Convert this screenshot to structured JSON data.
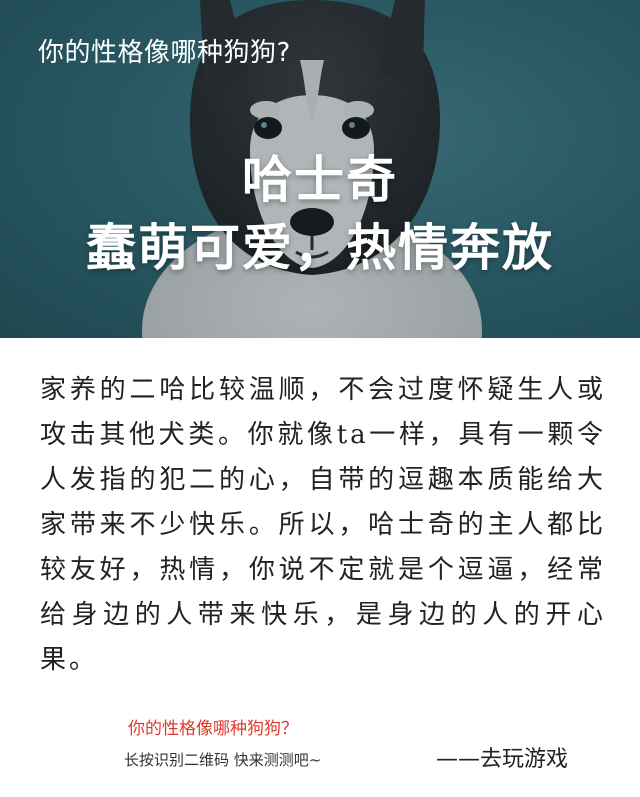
{
  "hero": {
    "question": "你的性格像哪种狗狗?",
    "title_line1": "哈士奇",
    "title_line2": "蠢萌可爱，热情奔放"
  },
  "description": "家养的二哈比较温顺，不会过度怀疑生人或攻击其他犬类。你就像ta一样，具有一颗令人发指的犯二的心，自带的逗趣本质能给大家带来不少快乐。所以，哈士奇的主人都比较友好，热情，你说不定就是个逗逼，经常给身边的人带来快乐，是身边的人的开心果。",
  "footer": {
    "question": "你的性格像哪种狗狗？",
    "hint": "长按识别二维码   快来测测吧~",
    "cta": "——去玩游戏"
  },
  "colors": {
    "hero_background": "#2e6874",
    "accent_red": "#e03a2f",
    "text_dark": "#222222"
  }
}
